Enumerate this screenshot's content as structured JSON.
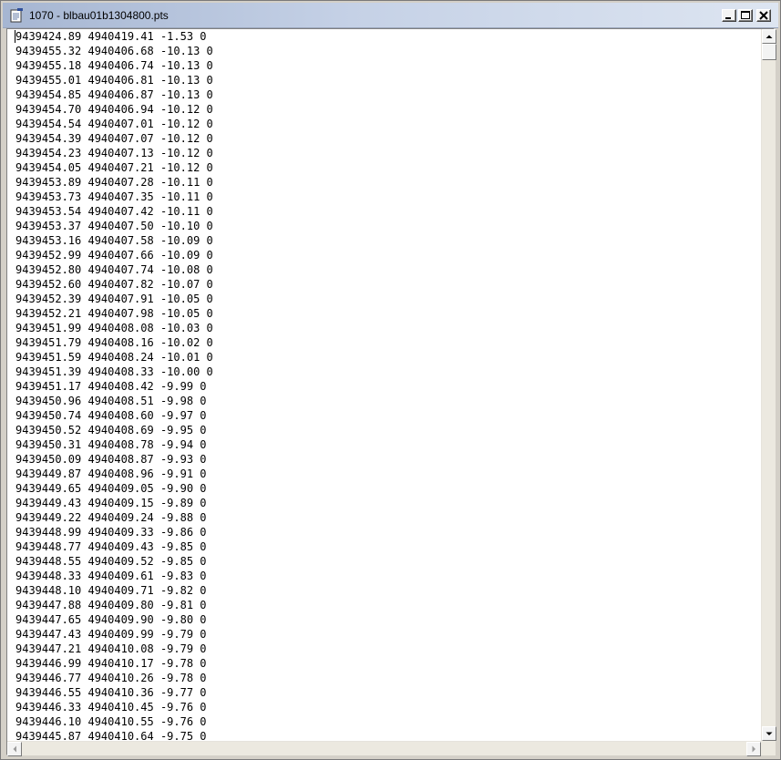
{
  "window": {
    "title": "1070 - blbau01b1304800.pts",
    "icon": "notepad-document-icon"
  },
  "controls": {
    "minimize_icon": "minimize-icon",
    "maximize_icon": "maximize-icon",
    "close_icon": "close-icon"
  },
  "editor": {
    "lines": [
      "9439424.89 4940419.41 -1.53 0",
      "9439455.32 4940406.68 -10.13 0",
      "9439455.18 4940406.74 -10.13 0",
      "9439455.01 4940406.81 -10.13 0",
      "9439454.85 4940406.87 -10.13 0",
      "9439454.70 4940406.94 -10.12 0",
      "9439454.54 4940407.01 -10.12 0",
      "9439454.39 4940407.07 -10.12 0",
      "9439454.23 4940407.13 -10.12 0",
      "9439454.05 4940407.21 -10.12 0",
      "9439453.89 4940407.28 -10.11 0",
      "9439453.73 4940407.35 -10.11 0",
      "9439453.54 4940407.42 -10.11 0",
      "9439453.37 4940407.50 -10.10 0",
      "9439453.16 4940407.58 -10.09 0",
      "9439452.99 4940407.66 -10.09 0",
      "9439452.80 4940407.74 -10.08 0",
      "9439452.60 4940407.82 -10.07 0",
      "9439452.39 4940407.91 -10.05 0",
      "9439452.21 4940407.98 -10.05 0",
      "9439451.99 4940408.08 -10.03 0",
      "9439451.79 4940408.16 -10.02 0",
      "9439451.59 4940408.24 -10.01 0",
      "9439451.39 4940408.33 -10.00 0",
      "9439451.17 4940408.42 -9.99 0",
      "9439450.96 4940408.51 -9.98 0",
      "9439450.74 4940408.60 -9.97 0",
      "9439450.52 4940408.69 -9.95 0",
      "9439450.31 4940408.78 -9.94 0",
      "9439450.09 4940408.87 -9.93 0",
      "9439449.87 4940408.96 -9.91 0",
      "9439449.65 4940409.05 -9.90 0",
      "9439449.43 4940409.15 -9.89 0",
      "9439449.22 4940409.24 -9.88 0",
      "9439448.99 4940409.33 -9.86 0",
      "9439448.77 4940409.43 -9.85 0",
      "9439448.55 4940409.52 -9.85 0",
      "9439448.33 4940409.61 -9.83 0",
      "9439448.10 4940409.71 -9.82 0",
      "9439447.88 4940409.80 -9.81 0",
      "9439447.65 4940409.90 -9.80 0",
      "9439447.43 4940409.99 -9.79 0",
      "9439447.21 4940410.08 -9.79 0",
      "9439446.99 4940410.17 -9.78 0",
      "9439446.77 4940410.26 -9.78 0",
      "9439446.55 4940410.36 -9.77 0",
      "9439446.33 4940410.45 -9.76 0",
      "9439446.10 4940410.55 -9.76 0",
      "9439445.87 4940410.64 -9.75 0"
    ]
  },
  "scrollbars": {
    "vertical": {
      "position": 0.0,
      "up_icon": "scroll-up-arrow-icon",
      "down_icon": "scroll-down-arrow-icon"
    },
    "horizontal": {
      "position": 0.0,
      "left_icon": "scroll-left-arrow-icon",
      "right_icon": "scroll-right-arrow-icon"
    }
  }
}
